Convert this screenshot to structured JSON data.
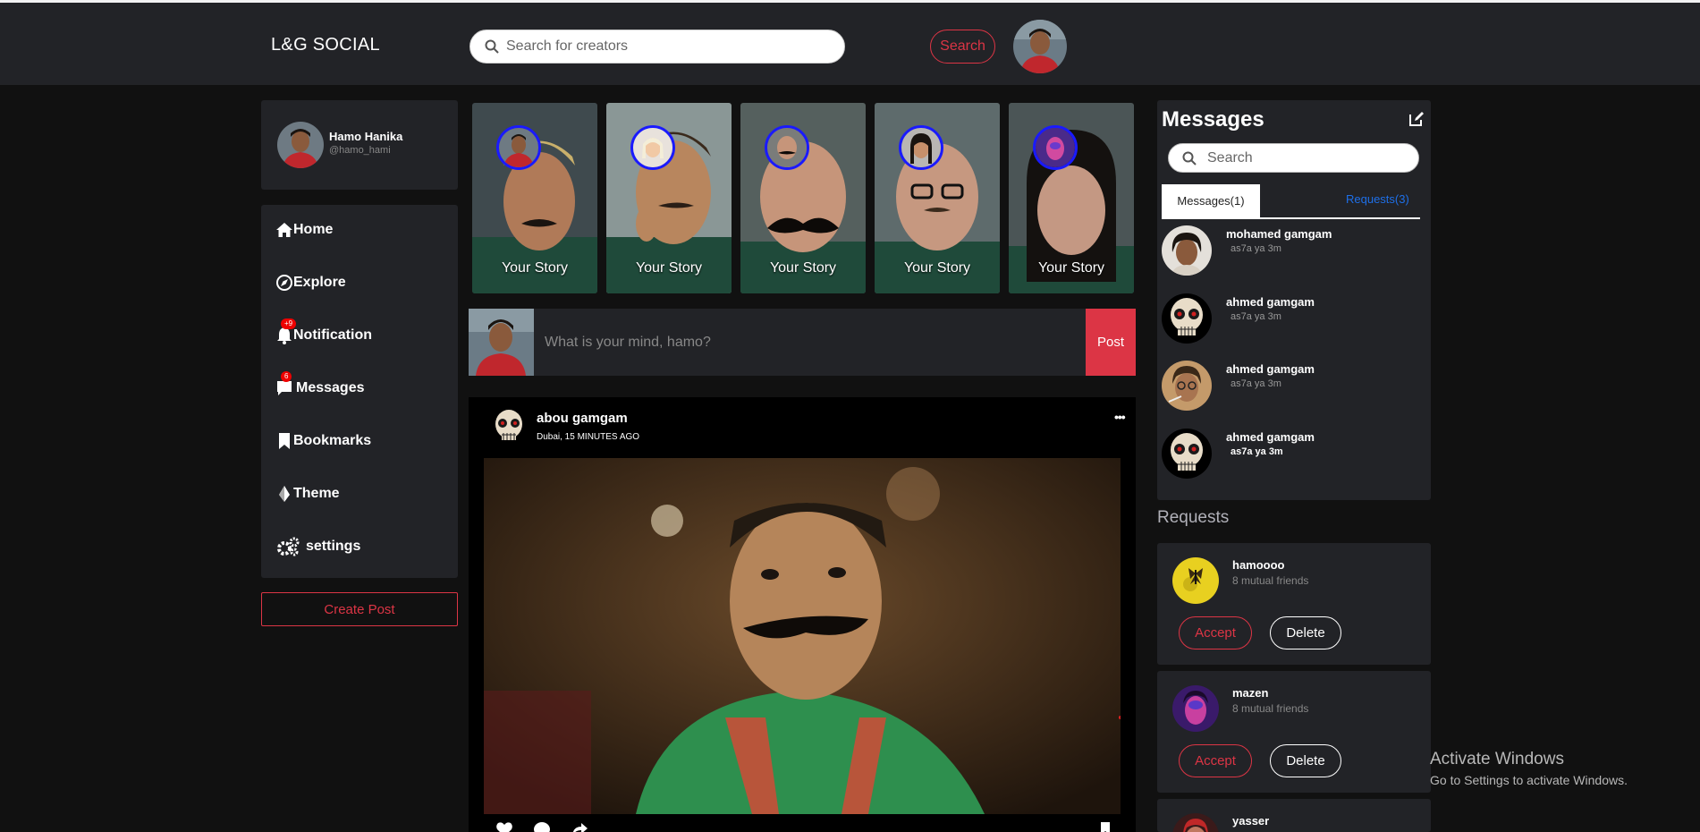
{
  "header": {
    "logo": "L&G SOCIAL",
    "search_placeholder": "Search for creators",
    "search_button": "Search"
  },
  "profile": {
    "name": "Hamo Hanika",
    "handle": "@hamo_hami"
  },
  "sidebar": {
    "items": [
      {
        "label": "Home",
        "icon": "home-icon"
      },
      {
        "label": "Explore",
        "icon": "compass-icon"
      },
      {
        "label": "Notification",
        "icon": "bell-icon",
        "badge": "+9"
      },
      {
        "label": "Messages",
        "icon": "chat-icon",
        "badge": "6"
      },
      {
        "label": "Bookmarks",
        "icon": "bookmark-icon"
      },
      {
        "label": "Theme",
        "icon": "palette-icon"
      },
      {
        "label": "settings",
        "icon": "gear-icon"
      }
    ],
    "create_post": "Create Post"
  },
  "stories": [
    {
      "label": "Your Story"
    },
    {
      "label": "Your Story"
    },
    {
      "label": "Your Story"
    },
    {
      "label": "Your Story"
    },
    {
      "label": "Your Story"
    }
  ],
  "composer": {
    "placeholder": "What is your mind, hamo?",
    "post_button": "Post"
  },
  "feed": {
    "post": {
      "author": "abou gamgam",
      "location_time": "Dubai, 15 MINUTES AGO",
      "more": "•••"
    }
  },
  "messages": {
    "title": "Messages",
    "search_placeholder": "Search",
    "tab_messages": "Messages(1)",
    "tab_requests": "Requests(3)",
    "items": [
      {
        "name": "mohamed gamgam",
        "text": "as7a ya 3m"
      },
      {
        "name": "ahmed gamgam",
        "text": "as7a ya 3m"
      },
      {
        "name": "ahmed gamgam",
        "text": "as7a ya 3m"
      },
      {
        "name": "ahmed gamgam",
        "text": "as7a ya 3m"
      }
    ]
  },
  "requests": {
    "title": "Requests",
    "items": [
      {
        "name": "hamoooo",
        "mutual": "8 mutual friends",
        "accept": "Accept",
        "delete": "Delete"
      },
      {
        "name": "mazen",
        "mutual": "8 mutual friends",
        "accept": "Accept",
        "delete": "Delete"
      },
      {
        "name": "yasser"
      }
    ]
  },
  "watermark": {
    "line1": "Activate Windows",
    "line2": "Go to Settings to activate Windows."
  }
}
